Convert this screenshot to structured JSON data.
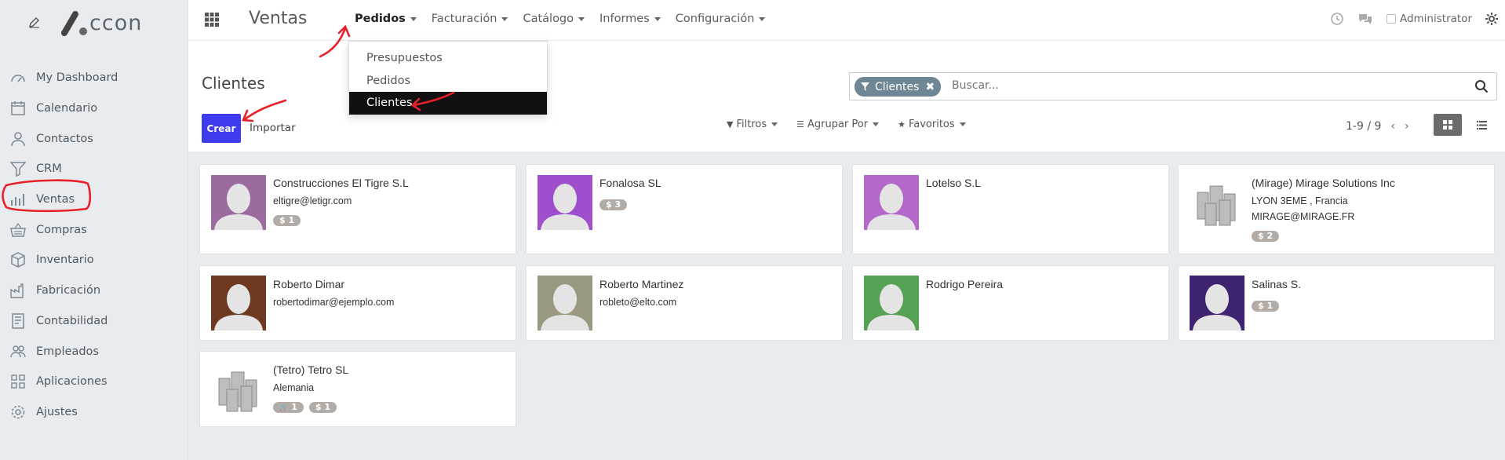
{
  "sidebar": {
    "logo_text": "ccon",
    "items": [
      {
        "label": "My Dashboard",
        "icon": "dashboard-icon"
      },
      {
        "label": "Calendario",
        "icon": "calendar-icon"
      },
      {
        "label": "Contactos",
        "icon": "user-icon"
      },
      {
        "label": "CRM",
        "icon": "funnel-icon"
      },
      {
        "label": "Ventas",
        "icon": "bar-chart-icon"
      },
      {
        "label": "Compras",
        "icon": "basket-icon"
      },
      {
        "label": "Inventario",
        "icon": "box-icon"
      },
      {
        "label": "Fabricación",
        "icon": "factory-icon"
      },
      {
        "label": "Contabilidad",
        "icon": "ledger-icon"
      },
      {
        "label": "Empleados",
        "icon": "people-icon"
      },
      {
        "label": "Aplicaciones",
        "icon": "grid-icon"
      },
      {
        "label": "Ajustes",
        "icon": "gear-icon"
      }
    ]
  },
  "topbar": {
    "app_title": "Ventas",
    "menu": [
      "Pedidos",
      "Facturación",
      "Catálogo",
      "Informes",
      "Configuración"
    ],
    "user": "Administrator"
  },
  "dropdown": {
    "items": [
      "Presupuestos",
      "Pedidos",
      "Clientes"
    ]
  },
  "control": {
    "breadcrumb": "Clientes",
    "create_label": "Crear",
    "import_label": "Importar",
    "facet_label": "Clientes",
    "facet_remove": "✖",
    "search_placeholder": "Buscar...",
    "filters_label": "Filtros",
    "group_label": "Agrupar Por",
    "favorites_label": "Favoritos",
    "pager": "1-9 / 9"
  },
  "customers": [
    {
      "name": "Construcciones El Tigre S.L",
      "lines": [
        "eltigre@letigr.com"
      ],
      "badges": [
        {
          "text": "$ 1"
        }
      ],
      "avatar": "person",
      "color": "#9b6a9e"
    },
    {
      "name": "Fonalosa SL",
      "lines": [],
      "badges": [
        {
          "text": "$ 3"
        }
      ],
      "avatar": "person",
      "color": "#9d4fce"
    },
    {
      "name": "Lotelso S.L",
      "lines": [],
      "badges": [],
      "avatar": "person",
      "color": "#b468cc"
    },
    {
      "name": "(Mirage) Mirage Solutions Inc",
      "lines": [
        "LYON 3EME , Francia",
        "MIRAGE@MIRAGE.FR"
      ],
      "badges": [
        {
          "text": "$ 2"
        }
      ],
      "avatar": "company",
      "color": "#ffffff"
    },
    {
      "name": "Roberto Dimar",
      "lines": [
        "robertodimar@ejemplo.com"
      ],
      "badges": [],
      "avatar": "person",
      "color": "#6e3a1f"
    },
    {
      "name": "Roberto Martinez",
      "lines": [
        "robleto@elto.com"
      ],
      "badges": [],
      "avatar": "person",
      "color": "#9a9880"
    },
    {
      "name": "Rodrigo Pereira",
      "lines": [],
      "badges": [],
      "avatar": "person",
      "color": "#55a155"
    },
    {
      "name": "Salinas S.",
      "lines": [],
      "badges": [
        {
          "text": "$ 1"
        }
      ],
      "avatar": "person",
      "color": "#3d2370"
    },
    {
      "name": "(Tetro) Tetro SL",
      "lines": [
        "Alemania"
      ],
      "badges": [
        {
          "text": "1",
          "icon": "cart"
        },
        {
          "text": "$ 1"
        }
      ],
      "avatar": "company",
      "color": "#ffffff"
    }
  ]
}
